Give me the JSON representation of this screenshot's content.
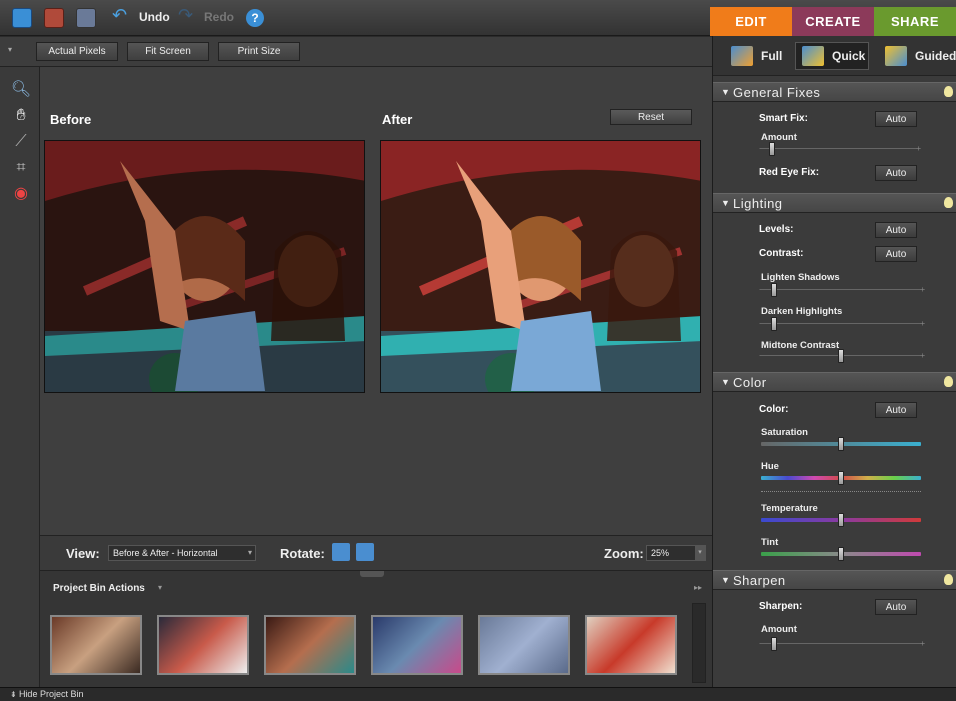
{
  "toolbar": {
    "undo_label": "Undo",
    "redo_label": "Redo",
    "help_label": "?"
  },
  "tabs": [
    {
      "label": "EDIT",
      "color": "#f07c1a"
    },
    {
      "label": "CREATE",
      "color": "#8c3a5a"
    },
    {
      "label": "SHARE",
      "color": "#6a9a2e"
    }
  ],
  "options": {
    "actual_pixels": "Actual Pixels",
    "fit_screen": "Fit Screen",
    "print_size": "Print Size"
  },
  "canvas": {
    "before_label": "Before",
    "after_label": "After",
    "reset_label": "Reset"
  },
  "viewbar": {
    "view_label": "View:",
    "view_value": "Before & After - Horizontal",
    "rotate_label": "Rotate:",
    "zoom_label": "Zoom:",
    "zoom_value": "25%"
  },
  "bin": {
    "actions_label": "Project Bin Actions",
    "hide_label": "Hide Project Bin"
  },
  "modes": {
    "full": "Full",
    "quick": "Quick",
    "guided": "Guided"
  },
  "general": {
    "title": "General Fixes",
    "smart_fix": "Smart Fix:",
    "amount": "Amount",
    "red_eye": "Red Eye Fix:",
    "auto": "Auto"
  },
  "lighting": {
    "title": "Lighting",
    "levels": "Levels:",
    "contrast": "Contrast:",
    "lighten_shadows": "Lighten Shadows",
    "darken_highlights": "Darken Highlights",
    "midtone_contrast": "Midtone Contrast",
    "auto": "Auto"
  },
  "color": {
    "title": "Color",
    "color_label": "Color:",
    "saturation": "Saturation",
    "hue": "Hue",
    "temperature": "Temperature",
    "tint": "Tint",
    "auto": "Auto"
  },
  "sharpen": {
    "title": "Sharpen",
    "sharpen_label": "Sharpen:",
    "amount": "Amount",
    "auto": "Auto"
  }
}
